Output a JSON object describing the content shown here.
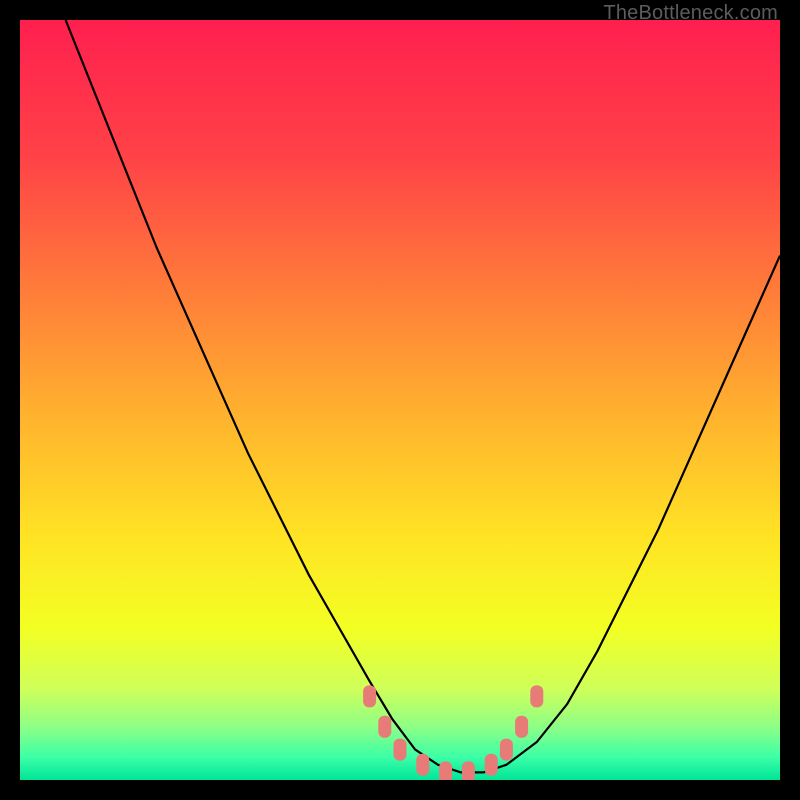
{
  "watermark": "TheBottleneck.com",
  "chart_data": {
    "type": "line",
    "title": "",
    "xlabel": "",
    "ylabel": "",
    "xlim": [
      0,
      100
    ],
    "ylim": [
      0,
      100
    ],
    "grid": false,
    "legend": false,
    "background_gradient": {
      "stops": [
        {
          "pos": 0.0,
          "color": "#ff1f4f"
        },
        {
          "pos": 0.18,
          "color": "#ff4247"
        },
        {
          "pos": 0.35,
          "color": "#ff7a3a"
        },
        {
          "pos": 0.52,
          "color": "#ffb22e"
        },
        {
          "pos": 0.68,
          "color": "#ffe324"
        },
        {
          "pos": 0.8,
          "color": "#f3ff23"
        },
        {
          "pos": 0.88,
          "color": "#cfff59"
        },
        {
          "pos": 0.93,
          "color": "#8eff86"
        },
        {
          "pos": 0.97,
          "color": "#3cffa7"
        },
        {
          "pos": 1.0,
          "color": "#00e598"
        }
      ]
    },
    "series": [
      {
        "name": "bottleneck-curve",
        "color": "#000000",
        "x": [
          6,
          10,
          14,
          18,
          22,
          26,
          30,
          34,
          38,
          42,
          46,
          49,
          52,
          55,
          58,
          61,
          64,
          68,
          72,
          76,
          80,
          84,
          88,
          92,
          96,
          100
        ],
        "y": [
          100,
          90,
          80,
          70,
          61,
          52,
          43,
          35,
          27,
          20,
          13,
          8,
          4,
          2,
          1,
          1,
          2,
          5,
          10,
          17,
          25,
          33,
          42,
          51,
          60,
          69
        ]
      }
    ],
    "markers": {
      "name": "highlight-points",
      "color": "#e77b78",
      "style": "rounded",
      "points": [
        {
          "x": 46,
          "y": 11
        },
        {
          "x": 48,
          "y": 7
        },
        {
          "x": 50,
          "y": 4
        },
        {
          "x": 53,
          "y": 2
        },
        {
          "x": 56,
          "y": 1
        },
        {
          "x": 59,
          "y": 1
        },
        {
          "x": 62,
          "y": 2
        },
        {
          "x": 64,
          "y": 4
        },
        {
          "x": 66,
          "y": 7
        },
        {
          "x": 68,
          "y": 11
        }
      ]
    }
  }
}
